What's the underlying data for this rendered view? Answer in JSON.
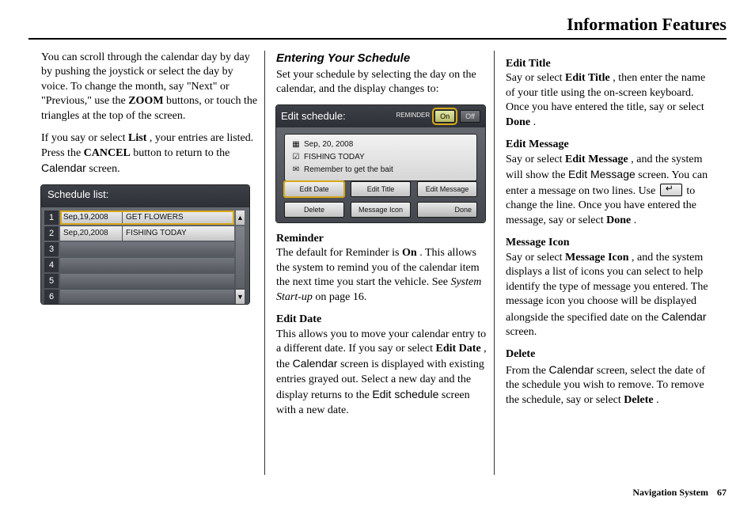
{
  "header": {
    "title": "Information Features"
  },
  "col1": {
    "p1a": "You can scroll through the calendar day by day by pushing the joystick or select the day by voice. To change the month, say \"Next\" or \"Previous,\" use the ",
    "p1b_bold": "ZOOM",
    "p1c": " buttons, or touch the triangles at the top of the screen.",
    "p2a": "If you say or select ",
    "p2b_bold": "List",
    "p2c": ", your entries are listed. Press the ",
    "p2d_bold": "CANCEL",
    "p2e": " button to return to the ",
    "p2f_ui": "Calendar",
    "p2g": " screen."
  },
  "schedule_list": {
    "title": "Schedule list:",
    "rows": [
      {
        "n": "1",
        "date": "Sep,19,2008",
        "text": "GET FLOWERS",
        "selected": true
      },
      {
        "n": "2",
        "date": "Sep,20,2008",
        "text": "FISHING TODAY",
        "selected": false
      },
      {
        "n": "3",
        "date": "",
        "text": "",
        "selected": false
      },
      {
        "n": "4",
        "date": "",
        "text": "",
        "selected": false
      },
      {
        "n": "5",
        "date": "",
        "text": "",
        "selected": false
      },
      {
        "n": "6",
        "date": "",
        "text": "",
        "selected": false
      }
    ],
    "scroll_up": "▲",
    "scroll_down": "▼"
  },
  "col2": {
    "heading": "Entering Your Schedule",
    "intro": "Set your schedule by selecting the day on the calendar, and the display changes to:",
    "reminder_h": "Reminder",
    "reminder_a": "The default for Reminder is ",
    "reminder_b_bold": "On",
    "reminder_c": ". This allows the system to remind you of the calendar item the next time you start the vehicle. See ",
    "reminder_d_it": "System Start-up",
    "reminder_e": " on page 16.",
    "editdate_h": "Edit Date",
    "editdate_a": "This allows you to move your calendar entry to a different date. If you say or select ",
    "editdate_b_bold": "Edit Date",
    "editdate_c": ", the ",
    "editdate_d_ui": "Calendar",
    "editdate_e": " screen is displayed with existing entries grayed out. Select a new day and the display returns to the ",
    "editdate_f_ui": "Edit schedule",
    "editdate_g": " screen with a new date."
  },
  "edit_schedule": {
    "title": "Edit schedule:",
    "reminder_label": "REMINDER",
    "reminder_on": "On",
    "reminder_off": "Off",
    "line1": "Sep, 20, 2008",
    "line2": "FISHING TODAY",
    "line3": "Remember to get the bait",
    "btn_edit_date": "Edit Date",
    "btn_edit_title": "Edit Title",
    "btn_edit_message": "Edit Message",
    "btn_delete": "Delete",
    "btn_message_icon": "Message Icon",
    "btn_done": "Done"
  },
  "col3": {
    "edittitle_h": "Edit Title",
    "edittitle_a": "Say or select ",
    "edittitle_b_bold": "Edit Title",
    "edittitle_c": ", then enter the name of your title using the on-screen keyboard. Once you have entered the title, say or select ",
    "edittitle_d_bold": "Done",
    "edittitle_e": ".",
    "editmsg_h": "Edit Message",
    "editmsg_a": "Say or select ",
    "editmsg_b_bold": "Edit Message",
    "editmsg_c": ", and the system will show the ",
    "editmsg_d_ui": "Edit Message",
    "editmsg_e": " screen. You can enter a message on two lines. Use ",
    "editmsg_f": " to change the line. Once you have entered the message, say or select ",
    "editmsg_g_bold": "Done",
    "editmsg_h2": ".",
    "msgicon_h": "Message Icon",
    "msgicon_a": "Say or select ",
    "msgicon_b_bold": "Message Icon",
    "msgicon_c": ", and the system displays a list of icons you can select to help identify the type of message you entered. The message icon you choose will be displayed alongside the specified date on the ",
    "msgicon_d_ui": "Calendar",
    "msgicon_e": " screen.",
    "delete_h": "Delete",
    "delete_a": "From the ",
    "delete_b_ui": "Calendar",
    "delete_c": " screen, select the date of the schedule you wish to remove. To remove the schedule, say or select ",
    "delete_d_bold": "Delete",
    "delete_e": "."
  },
  "footer": {
    "label": "Navigation System",
    "page": "67"
  }
}
